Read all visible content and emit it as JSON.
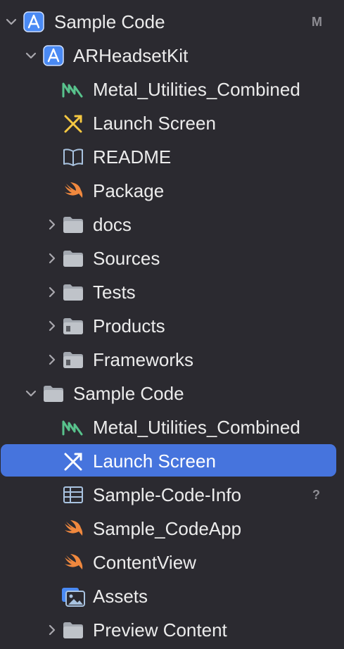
{
  "navigator": {
    "root": {
      "label": "Sample Code",
      "icon": "xcode-project-icon",
      "badge": "M",
      "expanded": true
    },
    "items": [
      {
        "label": "ARHeadsetKit",
        "icon": "xcode-project-icon",
        "level": 1,
        "disclosure": "expanded"
      },
      {
        "label": "Metal_Utilities_Combined",
        "icon": "metal-file-icon",
        "level": 2
      },
      {
        "label": "Launch Screen",
        "icon": "storyboard-icon",
        "level": 2
      },
      {
        "label": "README",
        "icon": "book-icon",
        "level": 2
      },
      {
        "label": "Package",
        "icon": "swift-icon",
        "level": 2
      },
      {
        "label": "docs",
        "icon": "folder-icon",
        "level": 2,
        "disclosure": "collapsed"
      },
      {
        "label": "Sources",
        "icon": "folder-icon",
        "level": 2,
        "disclosure": "collapsed"
      },
      {
        "label": "Tests",
        "icon": "folder-icon",
        "level": 2,
        "disclosure": "collapsed"
      },
      {
        "label": "Products",
        "icon": "folder-icon",
        "level": 2,
        "disclosure": "collapsed"
      },
      {
        "label": "Frameworks",
        "icon": "folder-icon",
        "level": 2,
        "disclosure": "collapsed"
      },
      {
        "label": "Sample Code",
        "icon": "folder-icon",
        "level": 1,
        "disclosure": "expanded"
      },
      {
        "label": "Metal_Utilities_Combined",
        "icon": "metal-file-icon",
        "level": 2
      },
      {
        "label": "Launch Screen",
        "icon": "storyboard-icon",
        "level": 2,
        "selected": true
      },
      {
        "label": "Sample-Code-Info",
        "icon": "plist-icon",
        "level": 2,
        "badge": "?"
      },
      {
        "label": "Sample_CodeApp",
        "icon": "swift-icon",
        "level": 2
      },
      {
        "label": "ContentView",
        "icon": "swift-icon",
        "level": 2
      },
      {
        "label": "Assets",
        "icon": "asset-catalog-icon",
        "level": 2
      },
      {
        "label": "Preview Content",
        "icon": "folder-icon",
        "level": 2,
        "disclosure": "collapsed"
      }
    ]
  },
  "colors": {
    "background": "#2b2a30",
    "selection": "#4674dd",
    "text": "#ececec",
    "swift": "#f0883e",
    "metal": "#58c28c",
    "folder": "#a3a8b0",
    "project": "#4a8af4"
  }
}
